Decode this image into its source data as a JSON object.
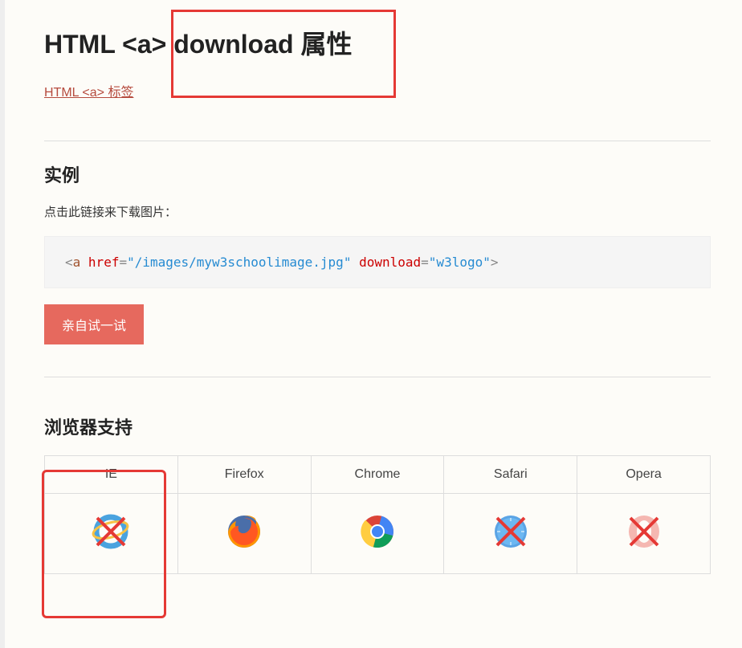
{
  "page": {
    "title": "HTML <a> download 属性",
    "back_link": "HTML <a> 标签"
  },
  "example": {
    "heading": "实例",
    "description": "点击此链接来下载图片：",
    "code": {
      "open_bracket": "<",
      "tag": "a",
      "space1": " ",
      "attr1": "href",
      "eq1": "=",
      "val1": "\"/images/myw3schoolimage.jpg\"",
      "space2": " ",
      "attr2": "download",
      "eq2": "=",
      "val2": "\"w3logo\"",
      "close_bracket": ">"
    },
    "try_button": "亲自试一试"
  },
  "browser": {
    "heading": "浏览器支持",
    "columns": [
      "IE",
      "Firefox",
      "Chrome",
      "Safari",
      "Opera"
    ],
    "support": [
      false,
      true,
      true,
      false,
      false
    ]
  }
}
